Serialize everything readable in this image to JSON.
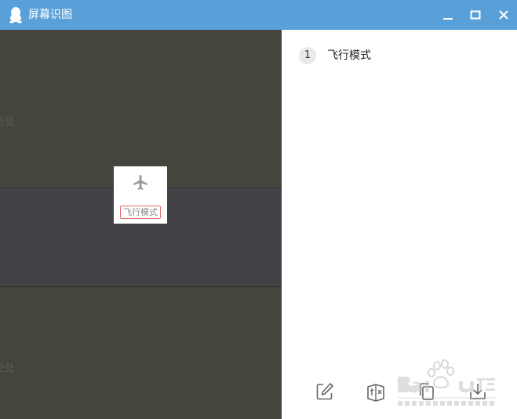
{
  "window": {
    "title": "屏幕识图",
    "icons": {
      "app": "qq-penguin-icon",
      "minimize": "minimize-icon",
      "maximize": "maximize-icon",
      "close": "close-icon"
    }
  },
  "capture": {
    "edge_text_top": "处处",
    "edge_text_bottom": "处处",
    "icon": "airplane-icon",
    "label": "飞行模式",
    "highlight_color": "#e06a6a"
  },
  "results": [
    {
      "index": "1",
      "text": "飞行模式"
    }
  ],
  "toolbar": {
    "icons": [
      "edit-icon",
      "translate-icon",
      "copy-icon",
      "download-icon"
    ]
  },
  "colors": {
    "titlebar": "#5aa0d8",
    "left_panel": "#45443d"
  }
}
